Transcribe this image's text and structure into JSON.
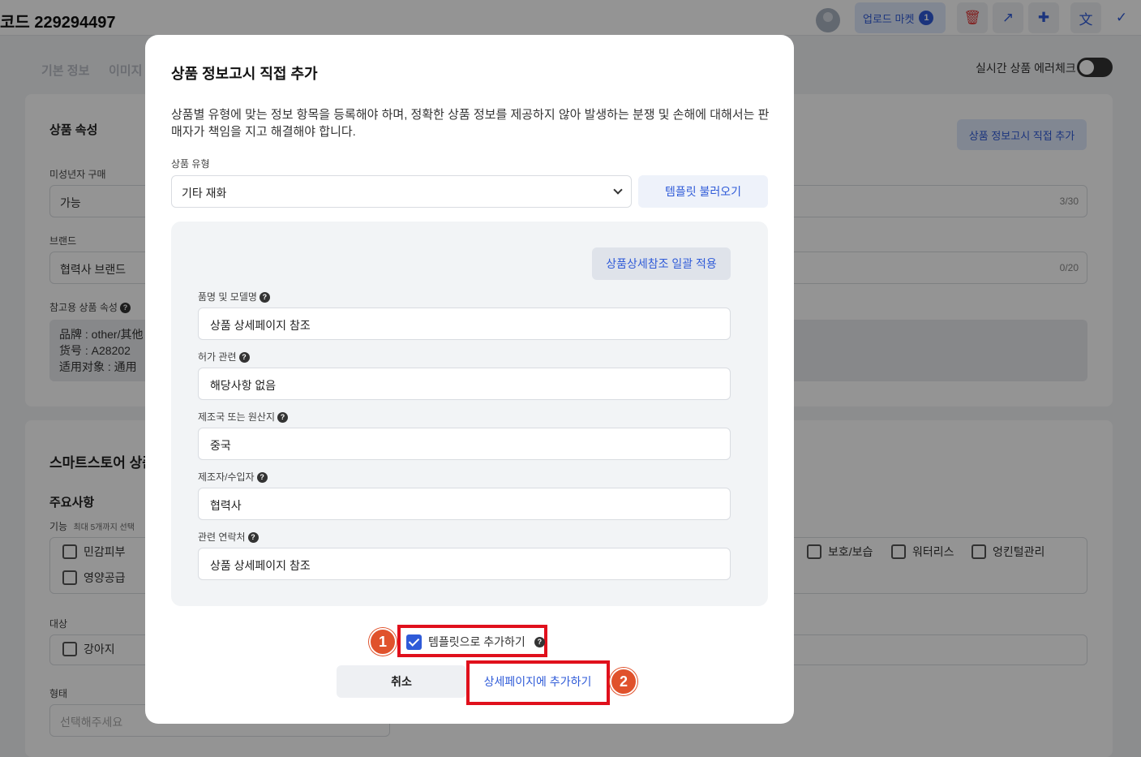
{
  "header": {
    "code_title": "코드 229294497",
    "upload_label": "업로드 마켓",
    "upload_count": "1",
    "icons": [
      "delete-icon",
      "external-link-icon",
      "file-add-icon",
      "translate-icon",
      "check-icon"
    ]
  },
  "tabs": [
    "기본 정보",
    "이미지"
  ],
  "realtime_check": {
    "label": "실시간 상품 에러체크"
  },
  "background": {
    "attr_title": "상품 속성",
    "minor_label": "미성년자 구매",
    "minor_value": "가능",
    "notice_btn": "상품 정보고시 직접 추가",
    "count1": "3/30",
    "brand_label": "브랜드",
    "brand_value": "협력사 브랜드",
    "count2": "0/20",
    "ref_label": "참고용 상품 속성",
    "ref_lines": [
      "品牌 : other/其他",
      "货号 : A28202",
      "适用对象 : 通用"
    ],
    "smart_title": "스마트스토어 상품",
    "notes_title": "주요사항",
    "func_label": "기능",
    "func_hint": "최대 5개까지 선택",
    "func_items_left": [
      "민감피부",
      "영양공급"
    ],
    "func_items_right": [
      "보호/보습",
      "워터리스",
      "엉킨털관리"
    ],
    "target_label": "대상",
    "target_items": [
      "강아지"
    ],
    "form_label": "형태",
    "form_placeholder": "선택해주세요"
  },
  "modal": {
    "title": "상품 정보고시 직접 추가",
    "description": "상품별 유형에 맞는 정보 항목을 등록해야 하며, 정확한 상품 정보를 제공하지 않아 발생하는 분쟁 및 손해에 대해서는 판매자가 책임을 지고 해결해야 합니다.",
    "type_label": "상품 유형",
    "type_value": "기타 재화",
    "template_btn": "템플릿 불러오기",
    "bulk_btn": "상품상세참조 일괄 적용",
    "fields": [
      {
        "label": "품명 및 모델명",
        "value": "상품 상세페이지 참조"
      },
      {
        "label": "허가 관련",
        "value": "해당사항 없음"
      },
      {
        "label": "제조국 또는 원산지",
        "value": "중국"
      },
      {
        "label": "제조자/수입자",
        "value": "협력사"
      },
      {
        "label": "관련 연락처",
        "value": "상품 상세페이지 참조"
      }
    ],
    "template_checkbox": "템플릿으로 추가하기",
    "cancel": "취소",
    "submit": "상세페이지에 추가하기",
    "step1": "1",
    "step2": "2"
  }
}
